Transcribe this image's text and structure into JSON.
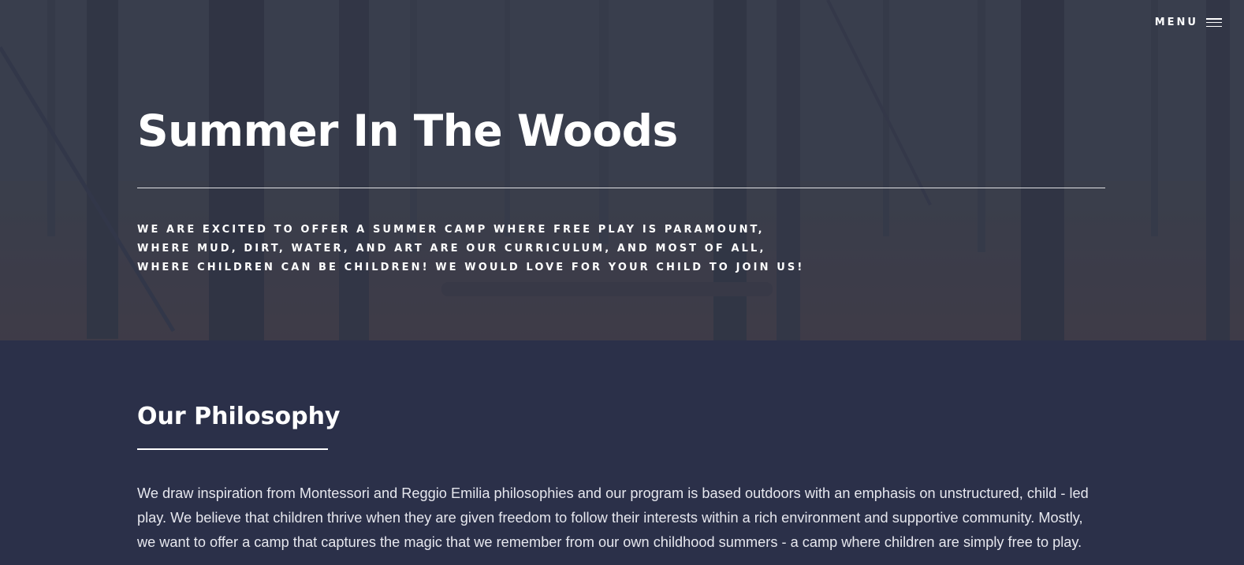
{
  "header": {
    "menu_label": "MENU"
  },
  "hero": {
    "title": "Summer In The Woods",
    "subtitle_lines": [
      "WE ARE EXCITED TO OFFER A SUMMER CAMP WHERE FREE PLAY IS PARAMOUNT,",
      "WHERE MUD, DIRT, WATER, AND ART ARE OUR CURRICULUM, AND MOST OF ALL,",
      "WHERE CHILDREN CAN BE CHILDREN! WE WOULD LOVE FOR YOUR CHILD TO JOIN US!"
    ]
  },
  "philosophy": {
    "title": "Our Philosophy",
    "body_lines": [
      "We draw inspiration from Montessori and Reggio Emilia philosophies and our program is based outdoors with an emphasis on unstructured, child - led",
      "play. We believe that children thrive when they are given freedom to follow their interests within a rich environment and supportive community. Mostly,",
      "we want to offer a camp that captures the magic that we remember from our own childhood summers - a camp where children are simply free to play."
    ]
  },
  "colors": {
    "page_background": "#2b3049",
    "hero_overlay": "#343856",
    "text": "#ffffff"
  },
  "icons": {
    "menu": "hamburger-icon"
  }
}
